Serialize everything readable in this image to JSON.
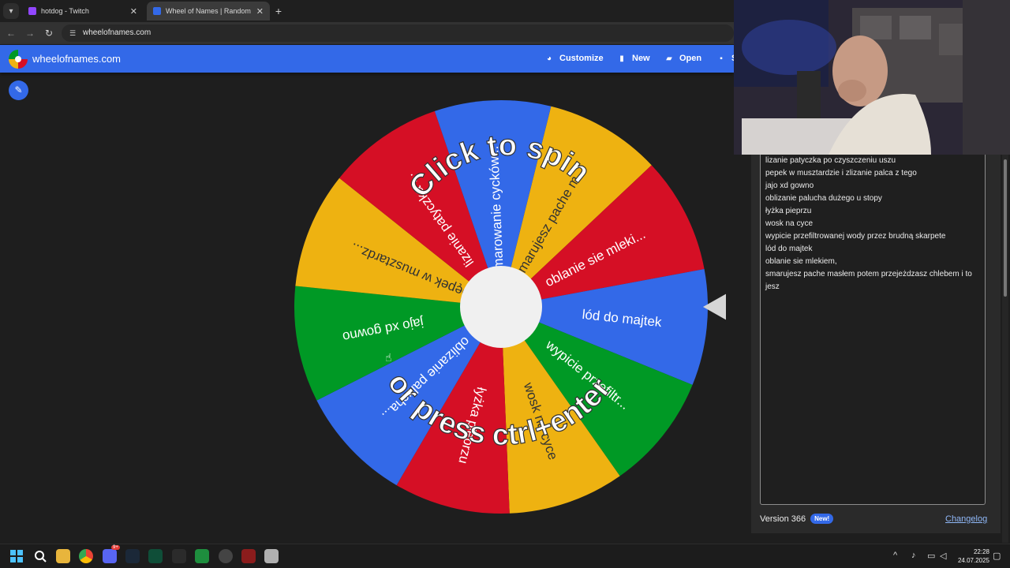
{
  "browser": {
    "tabs": [
      {
        "title": "hotdog - Twitch",
        "favicon_color": "#9146ff",
        "active": false
      },
      {
        "title": "Wheel of Names | Random name picker",
        "favicon_color": "#3369e8",
        "active": true
      }
    ],
    "new_tab_label": "+",
    "url": "wheelofnames.com"
  },
  "header": {
    "brand": "wheelofnames.com",
    "buttons": [
      {
        "label": "Customize",
        "icon": "palette-icon"
      },
      {
        "label": "New",
        "icon": "document-icon"
      },
      {
        "label": "Open",
        "icon": "folder-open-icon"
      },
      {
        "label": "S",
        "icon": "save-icon"
      }
    ]
  },
  "wheel": {
    "spin_text_top": "Click to spin",
    "spin_text_bottom": "or press ctrl+enter",
    "colors": {
      "blue": "#3369e8",
      "red": "#d50f25",
      "yellow": "#eeb211",
      "green": "#009925",
      "center": "#f0f0f0",
      "pointer": "#d6d6d6"
    },
    "segments": [
      {
        "label": "smarujesz pache m...",
        "color": "yellow"
      },
      {
        "label": "oblanie sie mleki...",
        "color": "red"
      },
      {
        "label": "lód do majtek",
        "color": "blue"
      },
      {
        "label": "wypicie przefiltr...",
        "color": "green"
      },
      {
        "label": "wosk na cyce",
        "color": "yellow"
      },
      {
        "label": "łyżka pieprzu",
        "color": "red"
      },
      {
        "label": "oblizanie palucha...",
        "color": "blue"
      },
      {
        "label": "jajo xd gowno",
        "color": "green"
      },
      {
        "label": "pępek w musztardz...",
        "color": "yellow"
      },
      {
        "label": "lizanie patyczka ...",
        "color": "red"
      },
      {
        "label": "Smarowanie cycków...",
        "color": "blue"
      }
    ]
  },
  "entries": [
    "lizanie patyczka po czyszczeniu uszu",
    "pepek w musztardzie i zlizanie palca z tego",
    "jajo xd gowno",
    "oblizanie palucha dużego u stopy",
    "łyżka pieprzu",
    "wosk na cyce",
    "wypicie przefiltrowanej wody przez brudną skarpete",
    "lód do majtek",
    "oblanie sie mlekiem,",
    "smarujesz pache masłem potem przejeżdzasz chlebem i to jesz"
  ],
  "footer": {
    "version": "Version 366",
    "badge": "New!",
    "changelog": "Changelog"
  },
  "taskbar": {
    "time": "22:28",
    "date": "24.07.2025",
    "discord_badge": "9+"
  }
}
